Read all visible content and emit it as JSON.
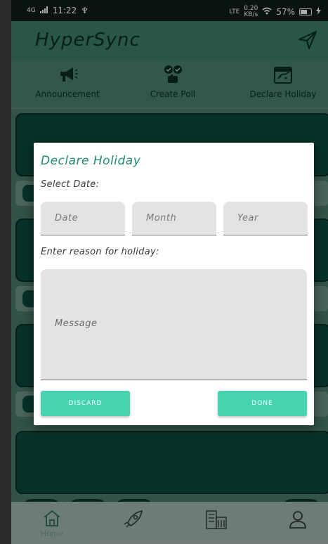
{
  "status_bar": {
    "time": "11:22",
    "network": "4G",
    "usb_symbol": "♆",
    "data_type": "LTE",
    "speed_value": "0.20",
    "speed_unit": "KB/s",
    "battery": "57%"
  },
  "app": {
    "title": "HyperSync",
    "title_color": "#0c2e26",
    "accent": "#1f8a74",
    "button_color": "#48d3b0"
  },
  "actions": [
    {
      "label": "Announcement",
      "icon": "megaphone-icon"
    },
    {
      "label": "Create Poll",
      "icon": "poll-icon"
    },
    {
      "label": "Declare Holiday",
      "icon": "calendar-holiday-icon"
    }
  ],
  "nav": [
    {
      "label": "Home",
      "icon": "home-icon"
    },
    {
      "label": "",
      "icon": "rocket-icon"
    },
    {
      "label": "",
      "icon": "buildings-icon"
    },
    {
      "label": "",
      "icon": "profile-icon"
    }
  ],
  "dialog": {
    "title": "Declare Holiday",
    "select_date_label": "Select Date:",
    "date_placeholder": "Date",
    "month_placeholder": "Month",
    "year_placeholder": "Year",
    "reason_label": "Enter reason for holiday:",
    "message_placeholder": "Message",
    "discard_label": "DISCARD",
    "done_label": "DONE"
  }
}
